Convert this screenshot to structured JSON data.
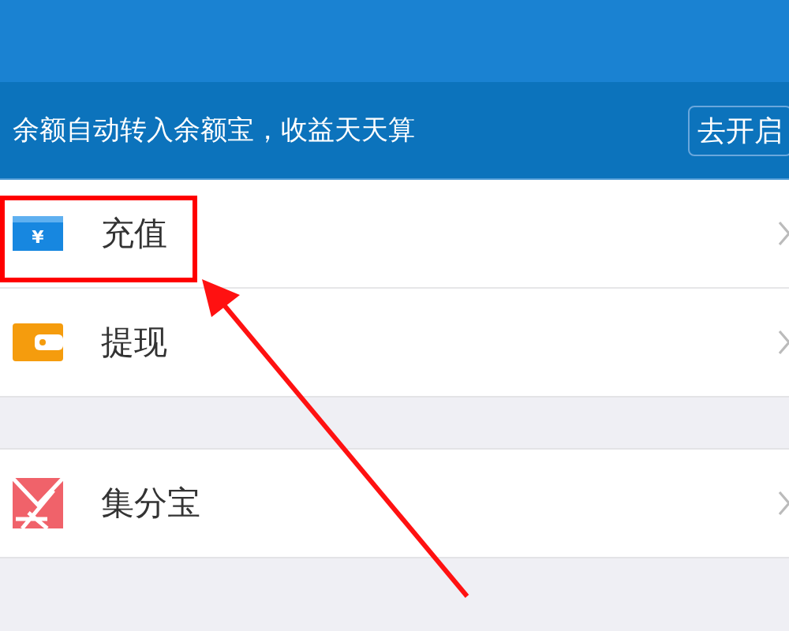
{
  "banner": {
    "text": "余额自动转入余额宝，收益天天算",
    "button": "去开启"
  },
  "groups": [
    {
      "items": [
        {
          "label": "充值",
          "kind": "card",
          "glyph": "¥",
          "highlighted": true
        },
        {
          "label": "提现",
          "kind": "wallet",
          "highlighted": false
        }
      ]
    },
    {
      "items": [
        {
          "label": "集分宝",
          "kind": "envelope",
          "highlighted": false
        }
      ]
    }
  ]
}
